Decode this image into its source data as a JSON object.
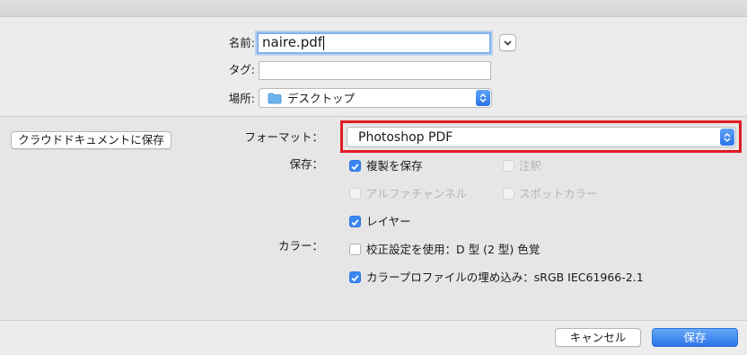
{
  "colors": {
    "accent": "#3b86f5",
    "highlight_border": "#e01b24"
  },
  "filename": {
    "label": "名前:",
    "value": "naire.pdf"
  },
  "tags": {
    "label": "タグ:",
    "value": ""
  },
  "location": {
    "label": "場所:",
    "value": "デスクトップ",
    "icon": "folder-icon"
  },
  "cloud_button": "クラウドドキュメントに保存",
  "format": {
    "label": "フォーマット：",
    "value": "Photoshop PDF"
  },
  "save_section": {
    "label": "保存：",
    "options": [
      {
        "label": "複製を保存",
        "checked": true,
        "enabled": true
      },
      {
        "label": "注釈",
        "checked": false,
        "enabled": false
      },
      {
        "label": "アルファチャンネル",
        "checked": false,
        "enabled": false
      },
      {
        "label": "スポットカラー",
        "checked": false,
        "enabled": false
      },
      {
        "label": "レイヤー",
        "checked": true,
        "enabled": true
      }
    ]
  },
  "color_section": {
    "label": "カラー：",
    "options": [
      {
        "label": "校正設定を使用：D 型 (2 型) 色覚",
        "checked": false,
        "enabled": true
      },
      {
        "label": "カラープロファイルの埋め込み：sRGB IEC61966-2.1",
        "checked": true,
        "enabled": true
      }
    ]
  },
  "buttons": {
    "cancel": "キャンセル",
    "save": "保存"
  }
}
